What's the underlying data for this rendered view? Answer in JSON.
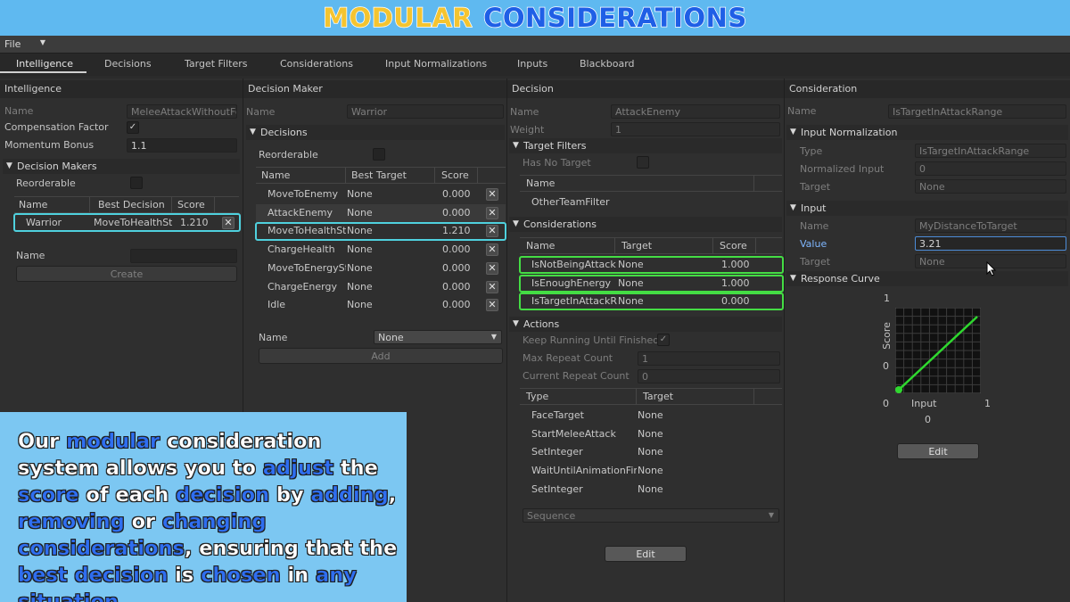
{
  "banner": {
    "word1": "MODULAR",
    "word2": "CONSIDERATIONS"
  },
  "menu": {
    "file": "File"
  },
  "tabs": [
    "Intelligence",
    "Decisions",
    "Target Filters",
    "Considerations",
    "Input Normalizations",
    "Inputs",
    "Blackboard"
  ],
  "intelligence": {
    "title": "Intelligence",
    "name_label": "Name",
    "name_value": "MeleeAttackWithoutFo",
    "comp_label": "Compensation Factor",
    "momentum_label": "Momentum Bonus",
    "momentum_value": "1.1",
    "dm_section": "Decision Makers",
    "reorderable": "Reorderable",
    "headers": [
      "Name",
      "Best Decision",
      "Score"
    ],
    "rows": [
      {
        "name": "Warrior",
        "best": "MoveToHealthSt",
        "score": "1.210"
      }
    ],
    "name2_label": "Name",
    "create": "Create"
  },
  "decision_maker": {
    "title": "Decision Maker",
    "name_label": "Name",
    "name_value": "Warrior",
    "section": "Decisions",
    "reorderable": "Reorderable",
    "headers": [
      "Name",
      "Best Target",
      "Score"
    ],
    "rows": [
      {
        "name": "MoveToEnemy",
        "target": "None",
        "score": "0.000"
      },
      {
        "name": "AttackEnemy",
        "target": "None",
        "score": "0.000"
      },
      {
        "name": "MoveToHealthSt",
        "target": "None",
        "score": "1.210"
      },
      {
        "name": "ChargeHealth",
        "target": "None",
        "score": "0.000"
      },
      {
        "name": "MoveToEnergySt",
        "target": "None",
        "score": "0.000"
      },
      {
        "name": "ChargeEnergy",
        "target": "None",
        "score": "0.000"
      },
      {
        "name": "Idle",
        "target": "None",
        "score": "0.000"
      }
    ],
    "name2_label": "Name",
    "dropdown": "None",
    "add": "Add"
  },
  "decision": {
    "title": "Decision",
    "name_label": "Name",
    "name_value": "AttackEnemy",
    "weight_label": "Weight",
    "weight_value": "1",
    "tf_section": "Target Filters",
    "no_target": "Has No Target",
    "tf_header": "Name",
    "tf_rows": [
      "OtherTeamFilter"
    ],
    "cons_section": "Considerations",
    "cons_headers": [
      "Name",
      "Target",
      "Score"
    ],
    "cons_rows": [
      {
        "name": "IsNotBeingAttack",
        "target": "None",
        "score": "1.000"
      },
      {
        "name": "IsEnoughEnergy",
        "target": "None",
        "score": "1.000"
      },
      {
        "name": "IsTargetInAttackR",
        "target": "None",
        "score": "0.000"
      }
    ],
    "actions_section": "Actions",
    "keep_running": "Keep Running Until Finished",
    "max_repeat": "Max Repeat Count",
    "max_repeat_value": "1",
    "cur_repeat": "Current Repeat Count",
    "cur_repeat_value": "0",
    "act_headers": [
      "Type",
      "Target"
    ],
    "act_rows": [
      {
        "type": "FaceTarget",
        "target": "None"
      },
      {
        "type": "StartMeleeAttack",
        "target": "None"
      },
      {
        "type": "SetInteger",
        "target": "None"
      },
      {
        "type": "WaitUntilAnimationFini",
        "target": "None"
      },
      {
        "type": "SetInteger",
        "target": "None"
      }
    ],
    "sequence": "Sequence",
    "edit": "Edit"
  },
  "consideration": {
    "title": "Consideration",
    "name_label": "Name",
    "name_value": "IsTargetInAttackRange",
    "norm_section": "Input Normalization",
    "type_label": "Type",
    "type_value": "IsTargetInAttackRange",
    "norm_input_label": "Normalized Input",
    "norm_input_value": "0",
    "target_label": "Target",
    "target_value": "None",
    "input_section": "Input",
    "in_name_label": "Name",
    "in_name_value": "MyDistanceToTarget",
    "value_label": "Value",
    "value_value": "3.21",
    "in_target_label": "Target",
    "in_target_value": "None",
    "curve_section": "Response Curve",
    "curve": {
      "y_max": "1",
      "y_min": "0",
      "x_min": "0",
      "x_max": "1",
      "ylabel": "Score",
      "xlabel": "Input",
      "input_value": "0",
      "line_color": "#2fd82f"
    },
    "edit": "Edit"
  },
  "caption": {
    "parts": [
      {
        "t": "Our ",
        "h": false
      },
      {
        "t": "modular",
        "h": true
      },
      {
        "t": " consideration system allows you to ",
        "h": false
      },
      {
        "t": "adjust",
        "h": true
      },
      {
        "t": " the ",
        "h": false
      },
      {
        "t": "score",
        "h": true
      },
      {
        "t": " of each ",
        "h": false
      },
      {
        "t": "decision",
        "h": true
      },
      {
        "t": " by ",
        "h": false
      },
      {
        "t": "adding",
        "h": true
      },
      {
        "t": ", ",
        "h": false
      },
      {
        "t": "removing",
        "h": true
      },
      {
        "t": " or ",
        "h": false
      },
      {
        "t": "changing considerations",
        "h": true
      },
      {
        "t": ", ensuring that the ",
        "h": false
      },
      {
        "t": "best decision",
        "h": true
      },
      {
        "t": " is ",
        "h": false
      },
      {
        "t": "chosen",
        "h": true
      },
      {
        "t": " in ",
        "h": false
      },
      {
        "t": "any situation",
        "h": true
      }
    ]
  }
}
